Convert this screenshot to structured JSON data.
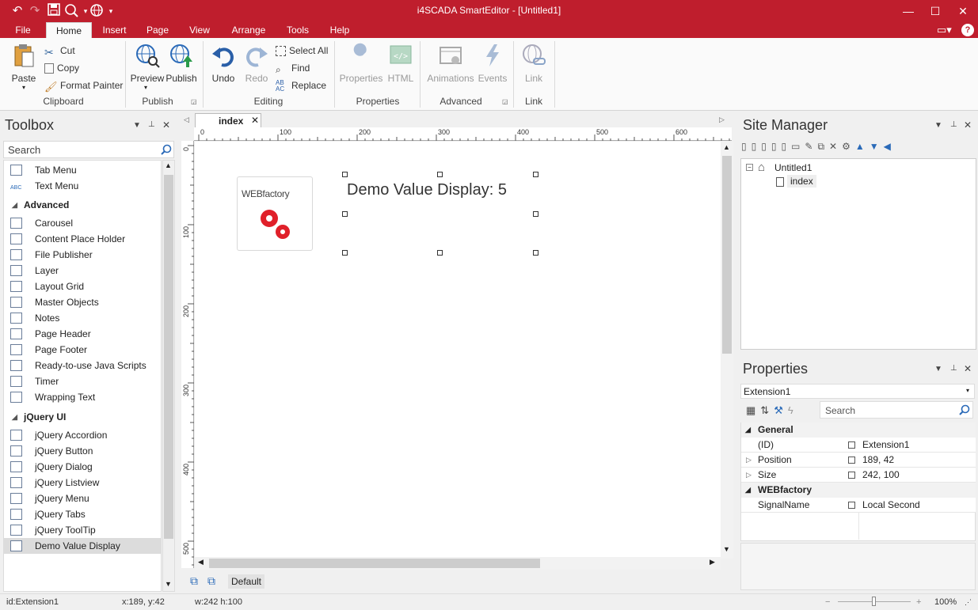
{
  "window": {
    "title": "i4SCADA SmartEditor - [Untitled1]"
  },
  "quick_access": {
    "undo": "undo-icon",
    "redo": "redo-icon",
    "save": "save-icon",
    "preview": "preview-icon",
    "publish": "publish-icon"
  },
  "ribbon_tabs": [
    "File",
    "Home",
    "Insert",
    "Page",
    "View",
    "Arrange",
    "Tools",
    "Help"
  ],
  "ribbon": {
    "clipboard": {
      "label": "Clipboard",
      "paste": "Paste",
      "cut": "Cut",
      "copy": "Copy",
      "format_painter": "Format Painter"
    },
    "publish": {
      "label": "Publish",
      "preview": "Preview",
      "publish": "Publish"
    },
    "editing": {
      "label": "Editing",
      "undo": "Undo",
      "redo": "Redo",
      "select_all": "Select All",
      "find": "Find",
      "replace": "Replace"
    },
    "properties": {
      "label": "Properties",
      "properties": "Properties",
      "html": "HTML"
    },
    "advanced": {
      "label": "Advanced",
      "animations": "Animations",
      "events": "Events"
    },
    "link": {
      "label": "Link",
      "link": "Link"
    }
  },
  "toolbox": {
    "title": "Toolbox",
    "search_placeholder": "Search",
    "items_top": [
      "Tab Menu",
      "Text Menu"
    ],
    "cat_advanced": "Advanced",
    "advanced_items": [
      "Carousel",
      "Content Place Holder",
      "File Publisher",
      "Layer",
      "Layout Grid",
      "Master Objects",
      "Notes",
      "Page Header",
      "Page Footer",
      "Ready-to-use Java Scripts",
      "Timer",
      "Wrapping Text"
    ],
    "cat_jquery": "jQuery UI",
    "jquery_items": [
      "jQuery Accordion",
      "jQuery Button",
      "jQuery Dialog",
      "jQuery Listview",
      "jQuery Menu",
      "jQuery Tabs",
      "jQuery ToolTip",
      "Demo Value Display"
    ]
  },
  "editor": {
    "tab": "index",
    "ruler_h": [
      "0",
      "100",
      "200",
      "300",
      "400",
      "500",
      "600"
    ],
    "ruler_v": [
      "0",
      "100",
      "200",
      "300",
      "400",
      "500"
    ],
    "logo_text": "WEBfactory",
    "display_text": "Demo Value Display: 5",
    "layer": "Default"
  },
  "site_manager": {
    "title": "Site Manager",
    "root": "Untitled1",
    "page": "index"
  },
  "properties": {
    "title": "Properties",
    "selected": "Extension1",
    "search_placeholder": "Search",
    "cat_general": "General",
    "rows_general": [
      {
        "name": "(ID)",
        "value": "Extension1",
        "exp": ""
      },
      {
        "name": "Position",
        "value": "189, 42",
        "exp": "▷"
      },
      {
        "name": "Size",
        "value": "242, 100",
        "exp": "▷"
      }
    ],
    "cat_webfactory": "WEBfactory",
    "rows_webfactory": [
      {
        "name": "SignalName",
        "value": "Local Second",
        "exp": ""
      }
    ]
  },
  "status": {
    "id": "id:Extension1",
    "pos": "x:189, y:42",
    "size": "w:242 h:100",
    "zoom": "100%"
  },
  "colors": {
    "brand": "#bf1e2d",
    "accent_blue": "#2a6ab8"
  }
}
